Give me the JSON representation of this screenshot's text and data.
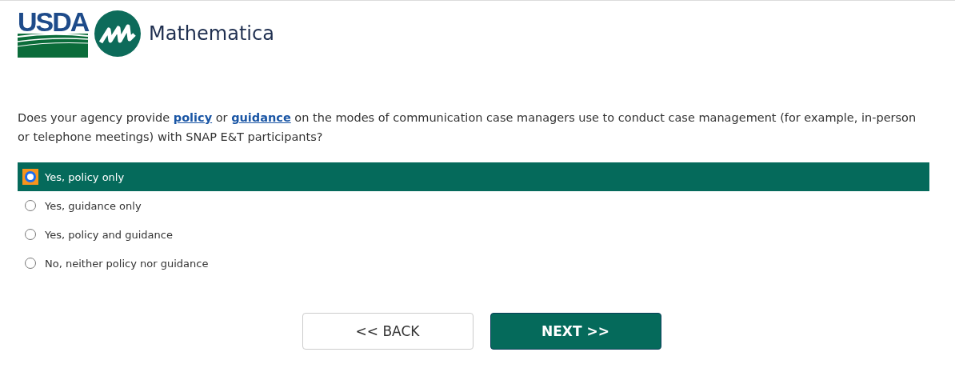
{
  "logos": {
    "usda": "USDA",
    "mathematica": "Mathematica"
  },
  "question": [
    {
      "kind": "text",
      "text": "Does your agency provide "
    },
    {
      "kind": "link",
      "text": "policy"
    },
    {
      "kind": "text",
      "text": " or "
    },
    {
      "kind": "link",
      "text": "guidance"
    },
    {
      "kind": "text",
      "text": " on the modes of communication case managers use to conduct case management (for example, in-person or telephone meetings) with SNAP E&T participants?"
    }
  ],
  "options": [
    {
      "label": "Yes, policy only",
      "selected": true
    },
    {
      "label": "Yes, guidance only",
      "selected": false
    },
    {
      "label": "Yes, policy and guidance",
      "selected": false
    },
    {
      "label": "No, neither policy nor guidance",
      "selected": false
    }
  ],
  "buttons": [
    {
      "kind": "back",
      "label": "<< BACK"
    },
    {
      "kind": "next",
      "label": "NEXT >>"
    }
  ]
}
